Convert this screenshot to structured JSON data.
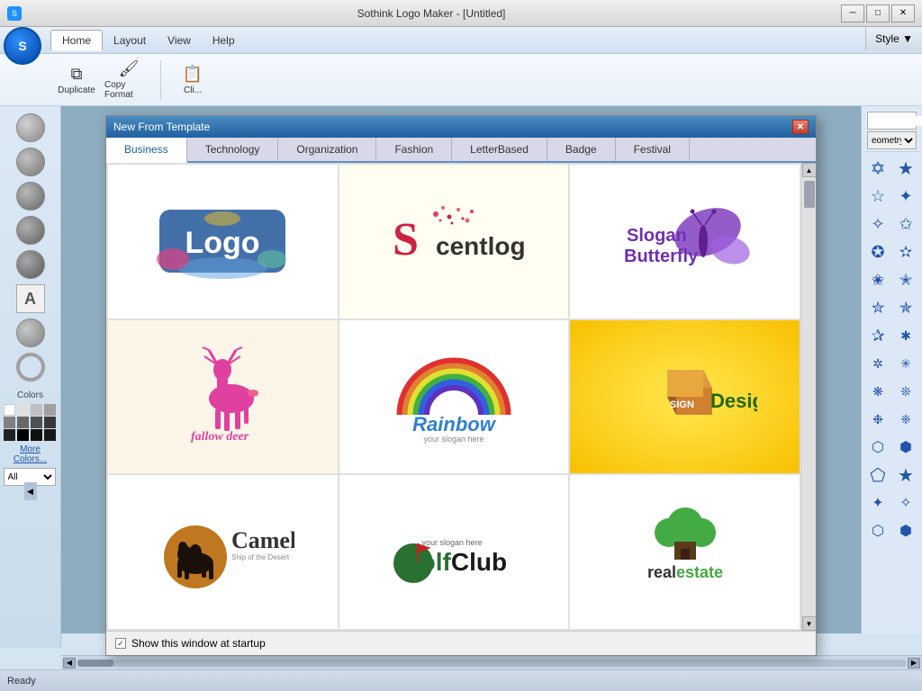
{
  "window": {
    "title": "Sothink Logo Maker - [Untitled]",
    "style_label": "Style ▼"
  },
  "titlebar": {
    "minimize": "─",
    "restore": "□",
    "close": "✕"
  },
  "applogo": "S",
  "menubar": {
    "items": [
      "Home",
      "Layout",
      "View",
      "Help"
    ]
  },
  "toolbar": {
    "duplicate_label": "Duplicate",
    "copy_format_label": "Copy Format",
    "clipboard_label": "Cli..."
  },
  "dialog": {
    "title": "New From Template",
    "tabs": [
      "Business",
      "Technology",
      "Organization",
      "Fashion",
      "LetterBased",
      "Badge",
      "Festival"
    ],
    "active_tab": "Business",
    "logos": [
      {
        "id": 1,
        "name": "logo-colorful",
        "bg": "white"
      },
      {
        "id": 2,
        "name": "scentlogo",
        "bg": "light-yellow"
      },
      {
        "id": 3,
        "name": "slogan-butterfly",
        "bg": "white"
      },
      {
        "id": 4,
        "name": "fallow-deer",
        "bg": "cream"
      },
      {
        "id": 5,
        "name": "rainbow",
        "bg": "white"
      },
      {
        "id": 6,
        "name": "sign-design",
        "bg": "yellow"
      },
      {
        "id": 7,
        "name": "camel",
        "bg": "white"
      },
      {
        "id": 8,
        "name": "golf-club",
        "bg": "white"
      },
      {
        "id": 9,
        "name": "realestate",
        "bg": "white"
      }
    ],
    "footer": {
      "checkbox_label": "Show this window at startup",
      "checked": true
    }
  },
  "left_panel": {
    "tools": [
      "circle1",
      "circle2",
      "circle3",
      "circle4",
      "circle5",
      "text",
      "circle6",
      "ring"
    ],
    "colors_label": "Colors",
    "more_colors": "More Colors...",
    "filter_label": "All"
  },
  "search": {
    "placeholder": "",
    "geometry_label": "eometry"
  },
  "status": {
    "ready": "Ready"
  },
  "shapes": {
    "items": [
      "★",
      "✦",
      "✧",
      "✩",
      "✪",
      "✫",
      "✬",
      "✭",
      "✮",
      "✯",
      "✰",
      "✱",
      "✲",
      "✳",
      "❋",
      "❊",
      "❉",
      "❈",
      "⬡",
      "⬢",
      "★",
      "✦",
      "✧",
      "✩",
      "✪",
      "✫",
      "⬡",
      "⬢"
    ]
  }
}
